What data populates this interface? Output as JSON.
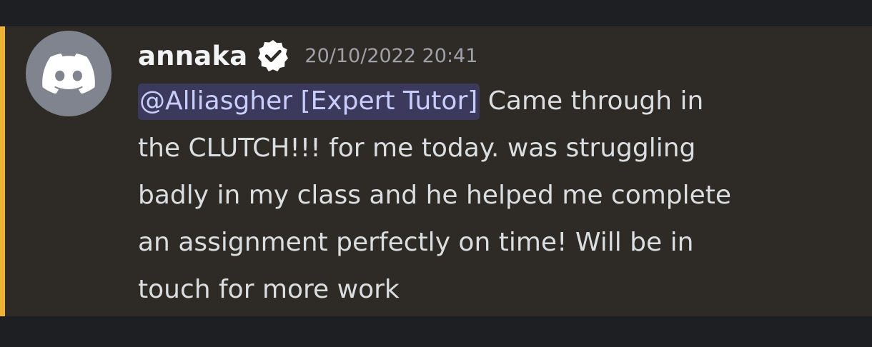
{
  "message": {
    "author": {
      "username": "annaka",
      "avatar_icon": "discord-logo-icon",
      "avatar_color": "#80848e",
      "verified_icon": "verified-badge-icon"
    },
    "timestamp": "20/10/2022 20:41",
    "mention": "@Alliasgher [Expert Tutor]",
    "text_lines": [
      " Came through in",
      "the CLUTCH!!! for me today. was struggling",
      "badly in my class and he helped me complete",
      "an assignment perfectly on time! Will be in",
      "touch for more work"
    ],
    "highlight_color": "#f0b232"
  }
}
